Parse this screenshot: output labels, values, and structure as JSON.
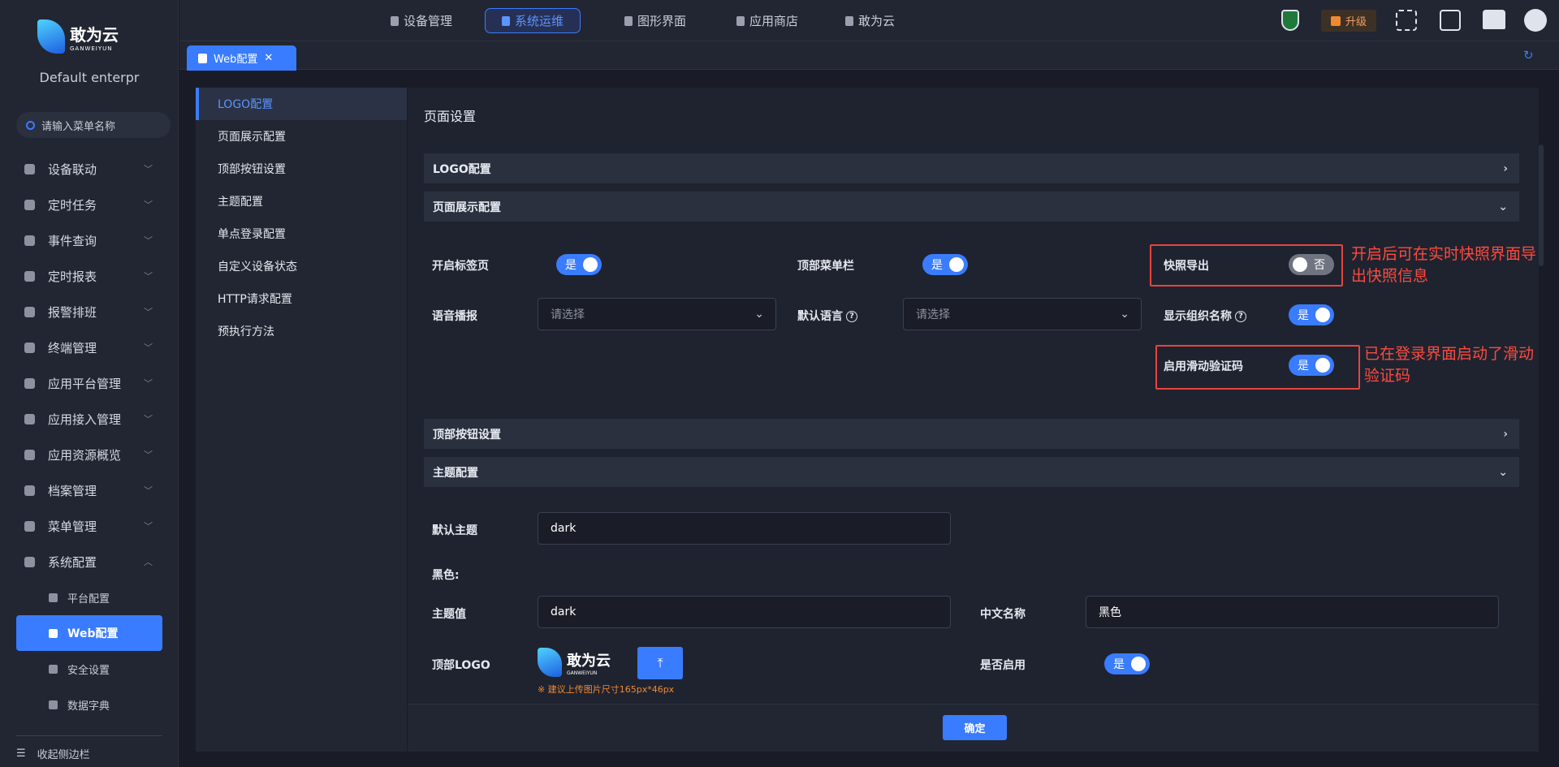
{
  "brand": {
    "name": "敢为云",
    "sub": "GANWEIYUN",
    "org": "Default enterpr"
  },
  "search": {
    "placeholder": "请输入菜单名称"
  },
  "sidebar": {
    "items": [
      {
        "label": "设备联动"
      },
      {
        "label": "定时任务"
      },
      {
        "label": "事件查询"
      },
      {
        "label": "定时报表"
      },
      {
        "label": "报警排班"
      },
      {
        "label": "终端管理"
      },
      {
        "label": "应用平台管理"
      },
      {
        "label": "应用接入管理"
      },
      {
        "label": "应用资源概览"
      },
      {
        "label": "档案管理"
      },
      {
        "label": "菜单管理"
      },
      {
        "label": "系统配置"
      }
    ],
    "sub": [
      {
        "label": "平台配置"
      },
      {
        "label": "Web配置"
      },
      {
        "label": "安全设置"
      },
      {
        "label": "数据字典"
      }
    ],
    "collapse": "收起侧边栏"
  },
  "topnav": [
    {
      "label": "设备管理"
    },
    {
      "label": "系统运维"
    },
    {
      "label": "图形界面"
    },
    {
      "label": "应用商店"
    },
    {
      "label": "敢为云"
    }
  ],
  "upgrade": "升级",
  "pagetab": {
    "label": "Web配置",
    "close": "✕"
  },
  "leftnav": [
    "LOGO配置",
    "页面展示配置",
    "顶部按钮设置",
    "主题配置",
    "单点登录配置",
    "自定义设备状态",
    "HTTP请求配置",
    "预执行方法"
  ],
  "content": {
    "title": "页面设置",
    "panels": {
      "logo": "LOGO配置",
      "display": "页面展示配置",
      "buttons": "顶部按钮设置",
      "theme": "主题配置"
    },
    "display": {
      "tabs": {
        "label": "开启标签页",
        "value": "是"
      },
      "topmenu": {
        "label": "顶部菜单栏",
        "value": "是"
      },
      "snapshot": {
        "label": "快照导出",
        "value": "否"
      },
      "voice": {
        "label": "语音播报",
        "placeholder": "请选择"
      },
      "lang": {
        "label": "默认语言",
        "placeholder": "请选择"
      },
      "orgname": {
        "label": "显示组织名称",
        "value": "是"
      },
      "captcha": {
        "label": "启用滑动验证码",
        "value": "是"
      }
    },
    "theme": {
      "default_label": "默认主题",
      "default_value": "dark",
      "black": "黑色:",
      "value_label": "主题值",
      "value": "dark",
      "cn_label": "中文名称",
      "cn_value": "黑色",
      "logo_label": "顶部LOGO",
      "hint": "※ 建议上传图片尺寸165px*46px",
      "enabled_label": "是否启用",
      "enabled": "是"
    },
    "confirm": "确定"
  },
  "annotations": [
    "开启后可在实时快照界面导出快照信息",
    "已在登录界面启动了滑动验证码"
  ]
}
